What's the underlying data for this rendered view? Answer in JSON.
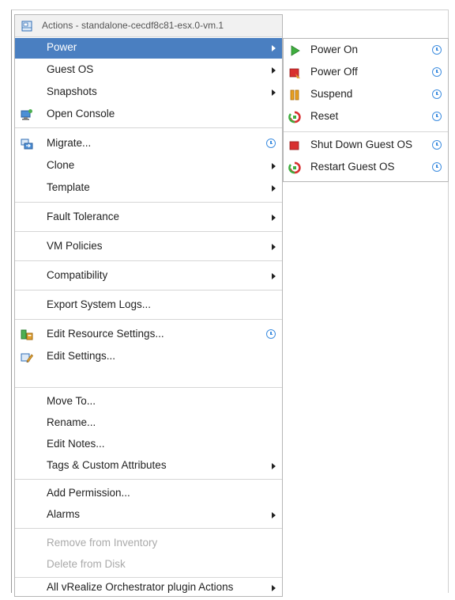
{
  "menu": {
    "title": "Actions - standalone-cecdf8c81-esx.0-vm.1",
    "items": [
      {
        "label": "Power",
        "submenu": true
      },
      {
        "label": "Guest OS",
        "submenu": true
      },
      {
        "label": "Snapshots",
        "submenu": true
      },
      {
        "label": "Open Console",
        "icon": "console-icon"
      },
      {
        "label": "Migrate...",
        "icon": "migrate-icon",
        "clock": true
      },
      {
        "label": "Clone",
        "submenu": true
      },
      {
        "label": "Template",
        "submenu": true
      },
      {
        "label": "Fault Tolerance",
        "submenu": true
      },
      {
        "label": "VM Policies",
        "submenu": true
      },
      {
        "label": "Compatibility",
        "submenu": true
      },
      {
        "label": "Export System Logs..."
      },
      {
        "label": "Edit Resource Settings...",
        "icon": "resource-settings-icon",
        "clock": true
      },
      {
        "label": "Edit Settings...",
        "icon": "edit-settings-icon"
      },
      {
        "label": "Move To..."
      },
      {
        "label": "Rename..."
      },
      {
        "label": "Edit Notes..."
      },
      {
        "label": "Tags & Custom Attributes",
        "submenu": true
      },
      {
        "label": "Add Permission..."
      },
      {
        "label": "Alarms",
        "submenu": true
      },
      {
        "label": "Remove from Inventory",
        "disabled": true
      },
      {
        "label": "Delete from Disk",
        "disabled": true
      },
      {
        "label": "All vRealize Orchestrator plugin Actions",
        "submenu": true
      }
    ]
  },
  "power_submenu": {
    "items": [
      {
        "label": "Power On",
        "icon": "power-on-icon",
        "clock": true
      },
      {
        "label": "Power Off",
        "icon": "power-off-icon",
        "clock": true
      },
      {
        "label": "Suspend",
        "icon": "suspend-icon",
        "clock": true
      },
      {
        "label": "Reset",
        "icon": "reset-icon",
        "clock": true
      },
      {
        "label": "Shut Down Guest OS",
        "icon": "shutdown-guest-icon",
        "clock": true
      },
      {
        "label": "Restart Guest OS",
        "icon": "restart-guest-icon",
        "clock": true
      }
    ]
  },
  "colors": {
    "selected_bg": "#4a7fc1",
    "clock_blue": "#3f8ee0",
    "disabled_text": "#aaaaaa"
  }
}
